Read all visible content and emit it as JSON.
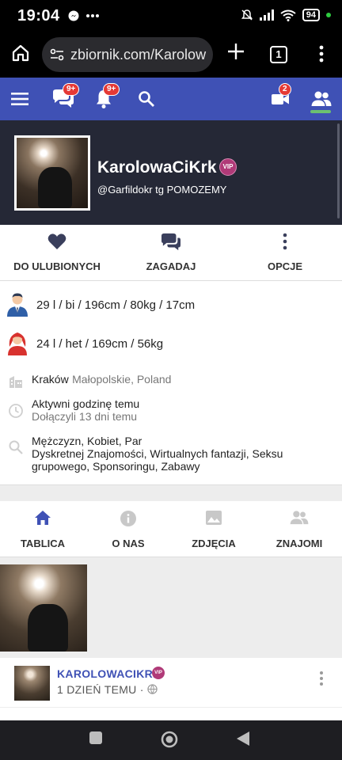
{
  "status_bar": {
    "time": "19:04",
    "left_icons": [
      "messenger-icon",
      "more-dots-icon"
    ],
    "right_icons": [
      "mute-bell-icon",
      "signal-icon",
      "wifi-icon"
    ],
    "battery": "94"
  },
  "browser": {
    "url": "zbiornik.com/Karolow",
    "tab_count": "1",
    "icons": [
      "home-icon",
      "site-settings-icon",
      "new-tab-plus-icon",
      "menu-dots-icon"
    ]
  },
  "site_nav": {
    "messages_badge": "9+",
    "notifications_badge": "9+",
    "video_badge": "2",
    "accent_color": "#3f51b5",
    "badge_color": "#e53935"
  },
  "profile": {
    "name": "KarolowaCiKrk",
    "vip": "VIP",
    "handle": "@Garfildokr tg POMOZEMY"
  },
  "actions": [
    {
      "label": "DO ULUBIONYCH",
      "icon": "heart-icon"
    },
    {
      "label": "ZAGADAJ",
      "icon": "chat-icon"
    },
    {
      "label": "OPCJE",
      "icon": "vertical-dots-icon"
    }
  ],
  "info": {
    "male": "29 l / bi / 196cm / 80kg / 17cm",
    "female": "24 l / het / 169cm / 56kg",
    "city": "Kraków",
    "region": "Małopolskie, Poland",
    "active": "Aktywni godzinę temu",
    "joined": "Dołączyli 13 dni temu",
    "looking_for": "Mężczyzn, Kobiet, Par",
    "interests": "Dyskretnej Znajomości, Wirtualnych fantazji, Seksu grupowego, Sponsoringu, Zabawy"
  },
  "tabs": [
    {
      "label": "TABLICA",
      "icon": "home-icon"
    },
    {
      "label": "O NAS",
      "icon": "info-icon"
    },
    {
      "label": "ZDJĘCIA",
      "icon": "image-icon"
    },
    {
      "label": "ZNAJOMI",
      "icon": "people-icon"
    }
  ],
  "post": {
    "author": "KAROLOWACIKRK",
    "vip": "VIP",
    "time": "1 DZIEŃ TEMU ·"
  }
}
